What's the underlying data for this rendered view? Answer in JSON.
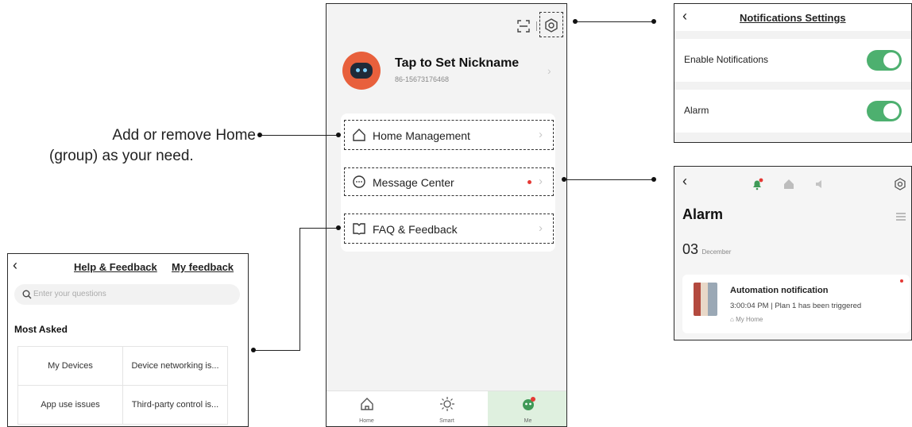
{
  "annotation": {
    "line1": "Add or remove Home",
    "line2": "(group) as your need."
  },
  "profile": {
    "name": "Tap to Set Nickname",
    "phone": "86-15673176468"
  },
  "menu": {
    "home_management": "Home Management",
    "message_center": "Message Center",
    "faq_feedback": "FAQ & Feedback"
  },
  "tabs": [
    {
      "label": "Home"
    },
    {
      "label": "Smart"
    },
    {
      "label": "Me"
    }
  ],
  "notifications": {
    "title": "Notifications Settings",
    "enable_label": "Enable Notifications",
    "alarm_label": "Alarm",
    "enable_on": true,
    "alarm_on": true
  },
  "alarm_panel": {
    "title": "Alarm",
    "day": "03",
    "month": "December",
    "card": {
      "title": "Automation notification",
      "detail": "3:00:04 PM | Plan 1 has been triggered",
      "home": "My Home"
    }
  },
  "help": {
    "title": "Help & Feedback",
    "my_feedback": "My feedback",
    "search_placeholder": "Enter your questions",
    "section": "Most Asked",
    "grid": [
      "My Devices",
      "Device networking is...",
      "App use issues",
      "Third-party control is..."
    ]
  },
  "colors": {
    "accent_green": "#4db06f",
    "badge_red": "#e53935",
    "avatar_orange": "#e8603c"
  }
}
